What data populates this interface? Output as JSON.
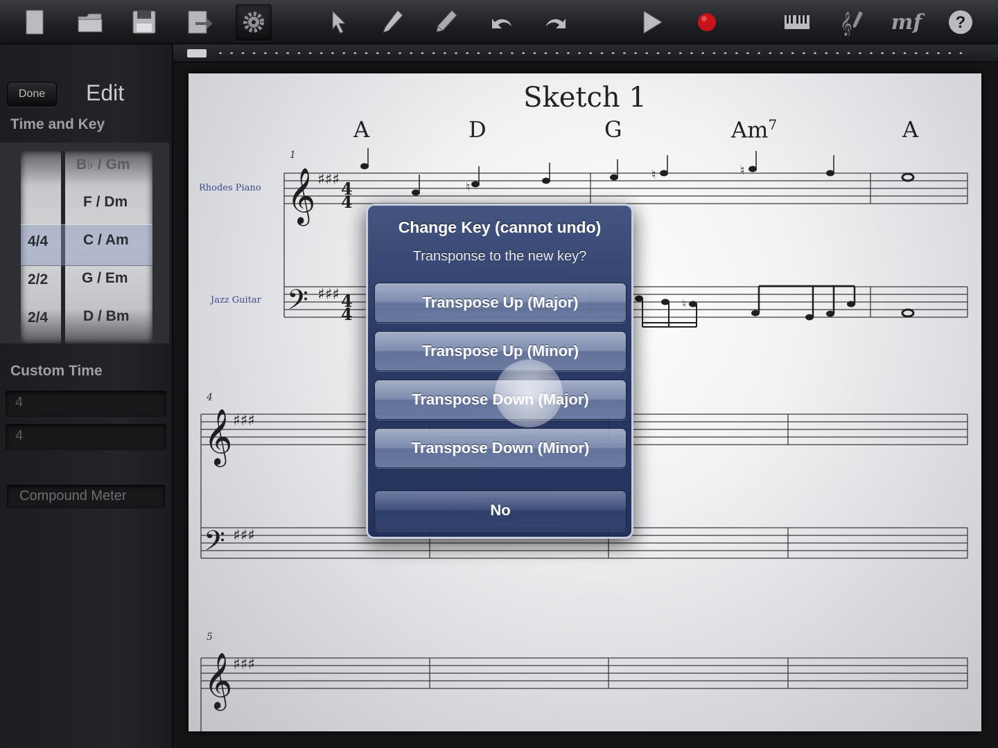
{
  "toolbar": {
    "icons": [
      "new-document-icon",
      "open-folder-icon",
      "save-icon",
      "export-icon",
      "settings-gear-icon",
      "select-arrow-icon",
      "pencil-icon",
      "eraser-icon",
      "undo-icon",
      "redo-icon",
      "play-icon",
      "record-icon",
      "keyboard-icon",
      "notation-tools-icon",
      "dynamics-icon",
      "help-icon"
    ],
    "dynamics_label": "mf"
  },
  "sidebar": {
    "done_label": "Done",
    "title": "Edit",
    "time_and_key_label": "Time and Key",
    "time_signatures": [
      "4/4",
      "2/2",
      "2/4"
    ],
    "selected_time": "4/4",
    "key_signatures": [
      "B♭ / Gm",
      "F / Dm",
      "C / Am",
      "G / Em",
      "D / Bm"
    ],
    "selected_key": "C / Am",
    "custom_time_label": "Custom Time",
    "custom_time_top": "4",
    "custom_time_bottom": "4",
    "compound_meter_label": "Compound Meter"
  },
  "score": {
    "title": "Sketch 1",
    "chords": [
      "A",
      "D",
      "G",
      "Am7",
      "A"
    ],
    "instruments": [
      "Rhodes Piano",
      "Jazz Guitar"
    ],
    "measure_numbers": [
      "1",
      "4",
      "5"
    ]
  },
  "alert": {
    "title": "Change Key (cannot undo)",
    "message": "Transponse to the new key?",
    "buttons": [
      "Transpose Up (Major)",
      "Transpose Up (Minor)",
      "Transpose Down (Major)",
      "Transpose Down (Minor)"
    ],
    "cancel_label": "No"
  },
  "colors": {
    "alert_bg": "#22335f",
    "record": "#c8121a",
    "instrument_label": "#3b4a8a"
  }
}
